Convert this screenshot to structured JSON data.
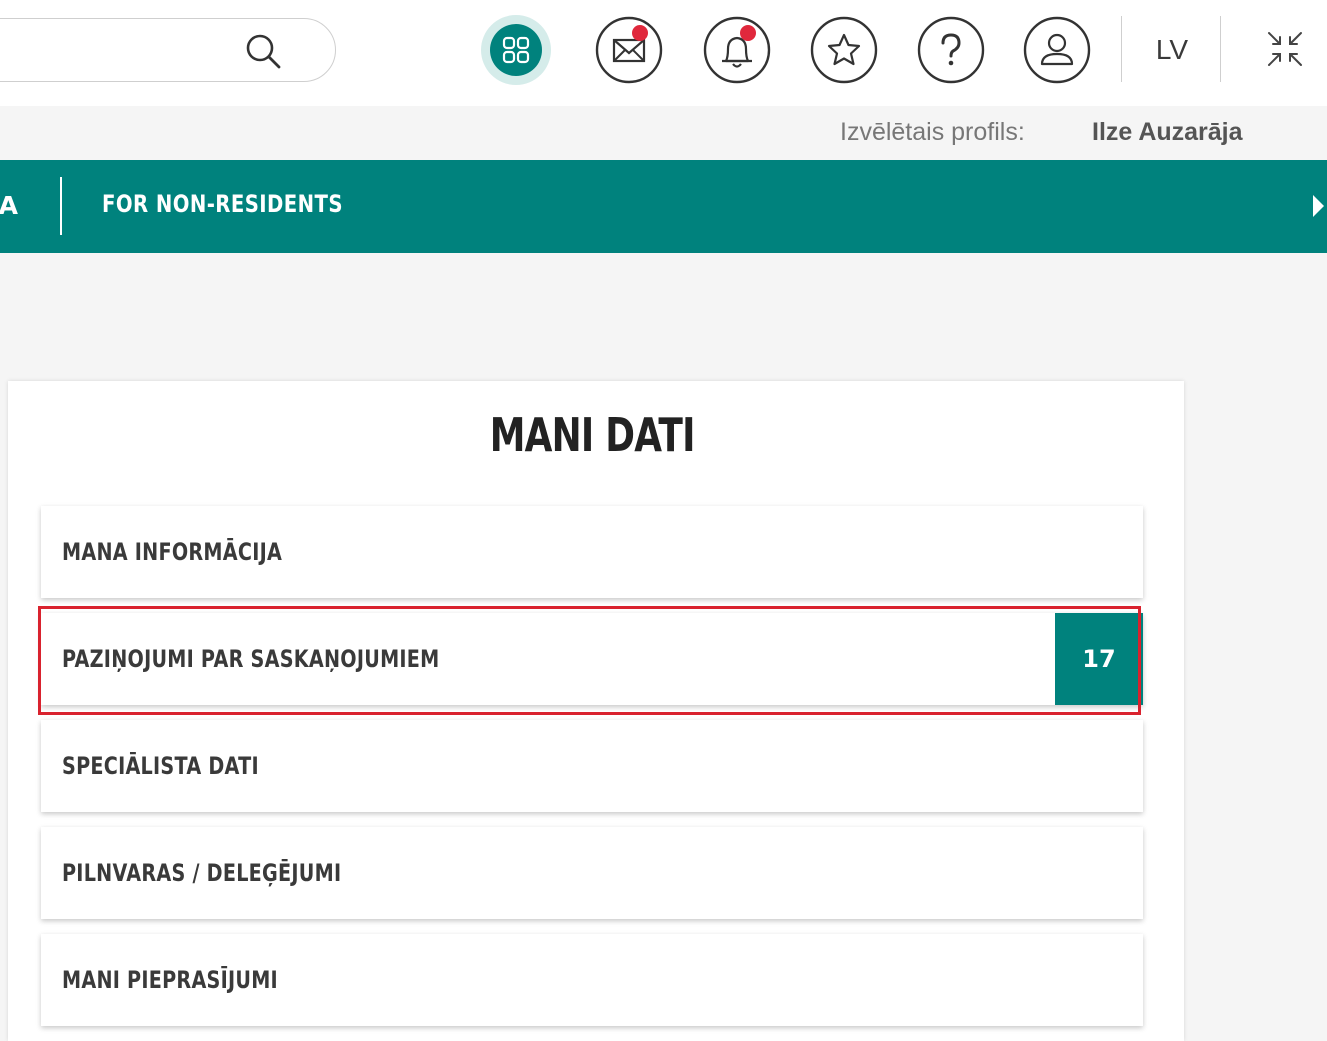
{
  "header": {
    "search": {
      "placeholder": "",
      "value": ""
    },
    "icons": [
      {
        "name": "apps-grid-icon",
        "active": true
      },
      {
        "name": "mail-icon",
        "has_notification": true
      },
      {
        "name": "bell-icon",
        "has_notification": true
      },
      {
        "name": "star-icon"
      },
      {
        "name": "help-icon",
        "glyph": "?"
      },
      {
        "name": "user-icon"
      }
    ],
    "language": "LV",
    "collapse_icon": "collapse-icon"
  },
  "profile": {
    "label": "Izvēlētais profils:",
    "name": "Ilze Auzarāja"
  },
  "nav": {
    "truncated_item": "A",
    "item": "FOR NON-RESIDENTS"
  },
  "card": {
    "title": "MANI DATI",
    "items": [
      {
        "label": "MANA INFORMĀCIJA"
      },
      {
        "label": "PAZIŅOJUMI PAR SASKAŅOJUMIEM",
        "count": "17",
        "highlighted": true
      },
      {
        "label": "SPECIĀLISTA DATI"
      },
      {
        "label": "PILNVARAS / DELEĢĒJUMI"
      },
      {
        "label": "MANI PIEPRASĪJUMI"
      }
    ]
  },
  "colors": {
    "brand_teal": "#00827d",
    "active_icon_bg": "#d5ecea",
    "notification_red": "#e0283c",
    "highlight_red": "#d9222e"
  }
}
